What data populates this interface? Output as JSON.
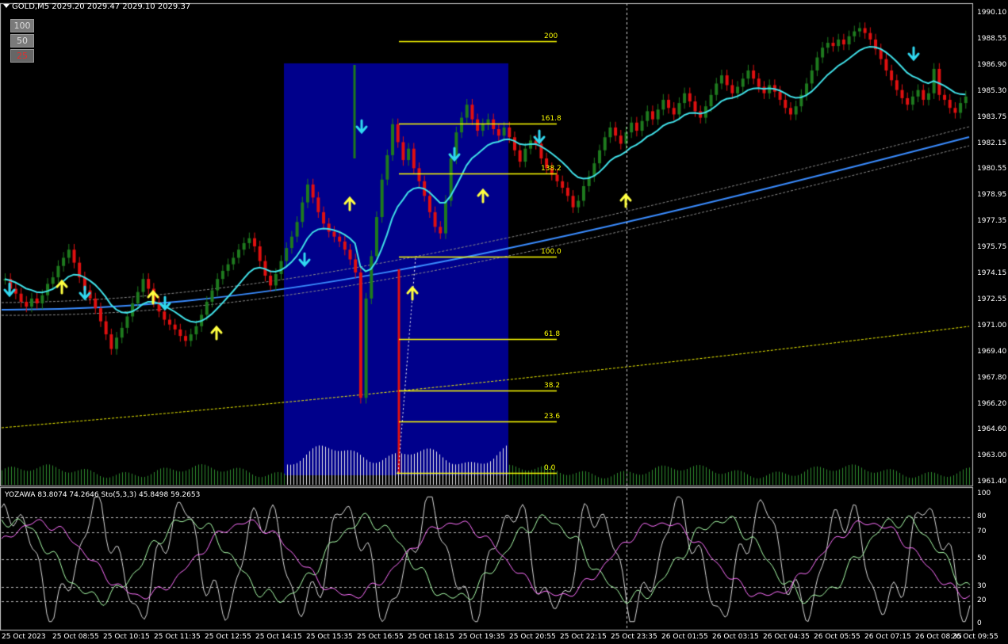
{
  "symbol_header": "GOLD,M5  2029.20 2029.47 2029.10 2029.37",
  "zoom_buttons": [
    "100",
    "50",
    "25"
  ],
  "indicator_header": "YOZAWA 83.8074 74.2646  Sto(5,3,3) 45.8498 59.2653",
  "price_axis": [
    "1990.10",
    "1988.55",
    "1986.90",
    "1985.30",
    "1983.75",
    "1982.15",
    "1980.55",
    "1978.95",
    "1977.35",
    "1975.75",
    "1974.15",
    "1972.55",
    "1971.00",
    "1969.40",
    "1967.80",
    "1966.20",
    "1964.60",
    "1963.00",
    "1961.40"
  ],
  "osc_axis": [
    "100",
    "80",
    "70",
    "50",
    "30",
    "20",
    "0"
  ],
  "time_axis": [
    "25 Oct 2023",
    "25 Oct 08:55",
    "25 Oct 10:15",
    "25 Oct 11:35",
    "25 Oct 12:55",
    "25 Oct 14:15",
    "25 Oct 15:35",
    "25 Oct 16:55",
    "25 Oct 18:15",
    "25 Oct 19:35",
    "25 Oct 20:55",
    "25 Oct 22:15",
    "25 Oct 23:35",
    "26 Oct 01:55",
    "26 Oct 03:15",
    "26 Oct 04:35",
    "26 Oct 05:55",
    "26 Oct 07:15",
    "26 Oct 08:35",
    "26 Oct 09:55"
  ],
  "fib_levels": [
    "200",
    "161.8",
    "138.2",
    "100.0",
    "61.8",
    "38.2",
    "23.6",
    "0.0"
  ],
  "colors": {
    "bull": "#1e7a1e",
    "bear": "#e01010",
    "fast_ma": "#40e0e8",
    "slow_ma": "#3a8cff",
    "long_ma": "#ffff00",
    "fib": "#ffff00",
    "zone": "#00008b",
    "buy_arrow": "#ffff40",
    "sell_arrow": "#30d8f0",
    "osc_green": "#aaffaa",
    "osc_pink": "#ff70ff"
  },
  "chart_data": {
    "type": "candlestick",
    "symbol": "GOLD",
    "timeframe": "M5",
    "ylim": [
      1961.4,
      1990.1
    ],
    "closes": [
      1973.8,
      1973.2,
      1972.9,
      1972.4,
      1972.1,
      1972.6,
      1972.3,
      1972.8,
      1973.5,
      1973.9,
      1974.6,
      1975.1,
      1975.6,
      1974.8,
      1973.9,
      1973.1,
      1972.6,
      1972.0,
      1971.2,
      1970.4,
      1969.5,
      1970.2,
      1970.8,
      1971.5,
      1972.3,
      1973.0,
      1973.8,
      1973.2,
      1972.4,
      1971.8,
      1971.3,
      1971.0,
      1970.7,
      1970.3,
      1970.0,
      1970.4,
      1970.9,
      1971.6,
      1972.4,
      1973.1,
      1973.8,
      1974.3,
      1974.7,
      1975.1,
      1975.6,
      1976.0,
      1976.3,
      1975.8,
      1974.9,
      1974.0,
      1973.4,
      1974.1,
      1974.9,
      1975.7,
      1976.4,
      1977.3,
      1978.5,
      1979.6,
      1978.8,
      1977.9,
      1977.2,
      1976.7,
      1976.4,
      1976.1,
      1975.6,
      1975.0,
      1974.2,
      1966.5,
      1972.6,
      1975.2,
      1977.6,
      1979.9,
      1981.4,
      1983.3,
      1982.2,
      1981.1,
      1981.8,
      1980.6,
      1979.8,
      1978.9,
      1977.9,
      1977.0,
      1976.6,
      1978.6,
      1981.2,
      1982.8,
      1983.7,
      1984.5,
      1983.6,
      1982.9,
      1983.3,
      1983.6,
      1983.0,
      1982.6,
      1983.1,
      1982.5,
      1981.7,
      1981.0,
      1981.8,
      1982.3,
      1982.1,
      1981.2,
      1980.6,
      1980.2,
      1979.8,
      1979.4,
      1978.9,
      1978.2,
      1978.6,
      1979.5,
      1980.1,
      1980.9,
      1981.7,
      1982.5,
      1983.1,
      1982.6,
      1982.1,
      1982.8,
      1983.4,
      1982.9,
      1983.5,
      1984.1,
      1983.6,
      1984.2,
      1984.8,
      1984.3,
      1983.9,
      1984.6,
      1985.2,
      1984.7,
      1984.1,
      1983.7,
      1984.4,
      1985.1,
      1985.8,
      1986.3,
      1985.7,
      1985.2,
      1985.6,
      1986.1,
      1986.6,
      1986.1,
      1985.6,
      1985.2,
      1985.7,
      1985.3,
      1984.8,
      1984.3,
      1983.9,
      1984.4,
      1985.1,
      1985.8,
      1986.6,
      1987.4,
      1988.0,
      1988.3,
      1988.1,
      1988.5,
      1988.2,
      1988.7,
      1989.0,
      1989.2,
      1988.9,
      1988.5,
      1987.9,
      1987.3,
      1986.6,
      1986.0,
      1985.4,
      1984.9,
      1984.5,
      1985.0,
      1985.4,
      1984.8,
      1985.2,
      1986.7,
      1985.1,
      1984.8,
      1984.3,
      1984.0,
      1984.6,
      1985.0
    ]
  }
}
